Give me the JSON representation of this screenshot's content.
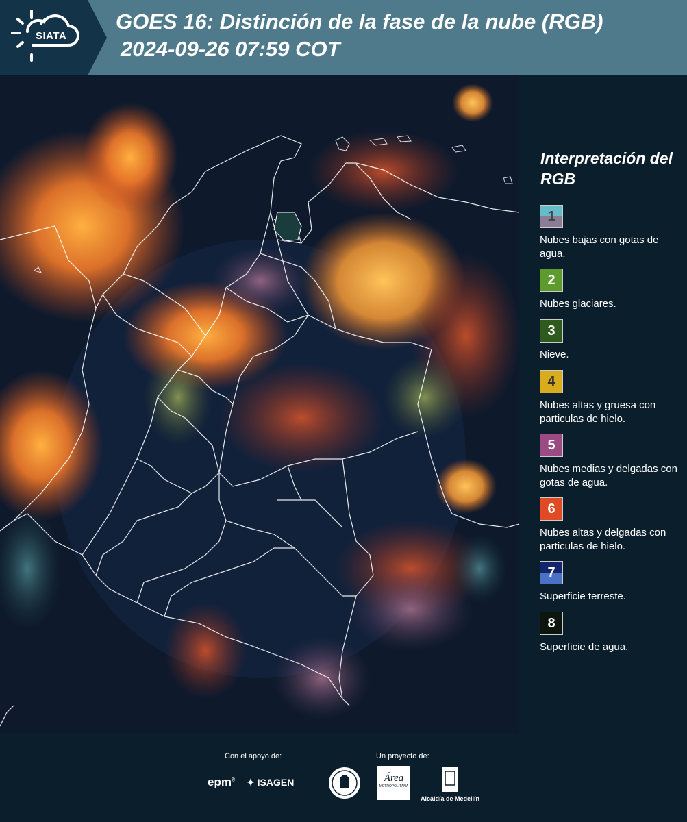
{
  "header": {
    "logo_text": "SIATA",
    "title_line1": "GOES 16: Distinción de la fase de la nube (RGB)",
    "title_line2": "2024-09-26 07:59 COT"
  },
  "legend": {
    "title": "Interpretación del RGB",
    "items": [
      {
        "number": "1",
        "label": "Nubes bajas con gotas de agua.",
        "color_top": "#66bcc8",
        "color_bottom": "#8a7d95",
        "num_color": "#444444"
      },
      {
        "number": "2",
        "label": "Nubes glaciares.",
        "color_top": "#5c9b2c",
        "color_bottom": "#5c9b2c",
        "num_color": "#ffffff"
      },
      {
        "number": "3",
        "label": "Nieve.",
        "color_top": "#2e5a1d",
        "color_bottom": "#2e5a1d",
        "num_color": "#ffffff"
      },
      {
        "number": "4",
        "label": "Nubes altas y gruesa con particulas de hielo.",
        "color_top": "#d9ac1d",
        "color_bottom": "#d9ac1d",
        "num_color": "#333333"
      },
      {
        "number": "5",
        "label": "Nubes medias y delgadas con gotas de agua.",
        "color_top": "#9b4a83",
        "color_bottom": "#9b4a83",
        "num_color": "#ffffff"
      },
      {
        "number": "6",
        "label": "Nubes altas y delgadas con particulas de hielo.",
        "color_top": "#e04a25",
        "color_bottom": "#e04a25",
        "num_color": "#ffffff"
      },
      {
        "number": "7",
        "label": "Superficie terreste.",
        "color_top": "#14266b",
        "color_bottom": "#4a72c4",
        "num_color": "#ffffff"
      },
      {
        "number": "8",
        "label": "Superficie de agua.",
        "color_top": "#0c160c",
        "color_bottom": "#0c160c",
        "num_color": "#ffffff"
      }
    ]
  },
  "footer": {
    "support_label": "Con el apoyo de:",
    "project_label": "Un proyecto de:",
    "epm_logo": "epm",
    "isagen_logo": "ISAGEN",
    "area_logo": "Área",
    "area_sub": "METROPOLITANA",
    "alcaldia_logo": "Alcaldía de Medellín"
  }
}
